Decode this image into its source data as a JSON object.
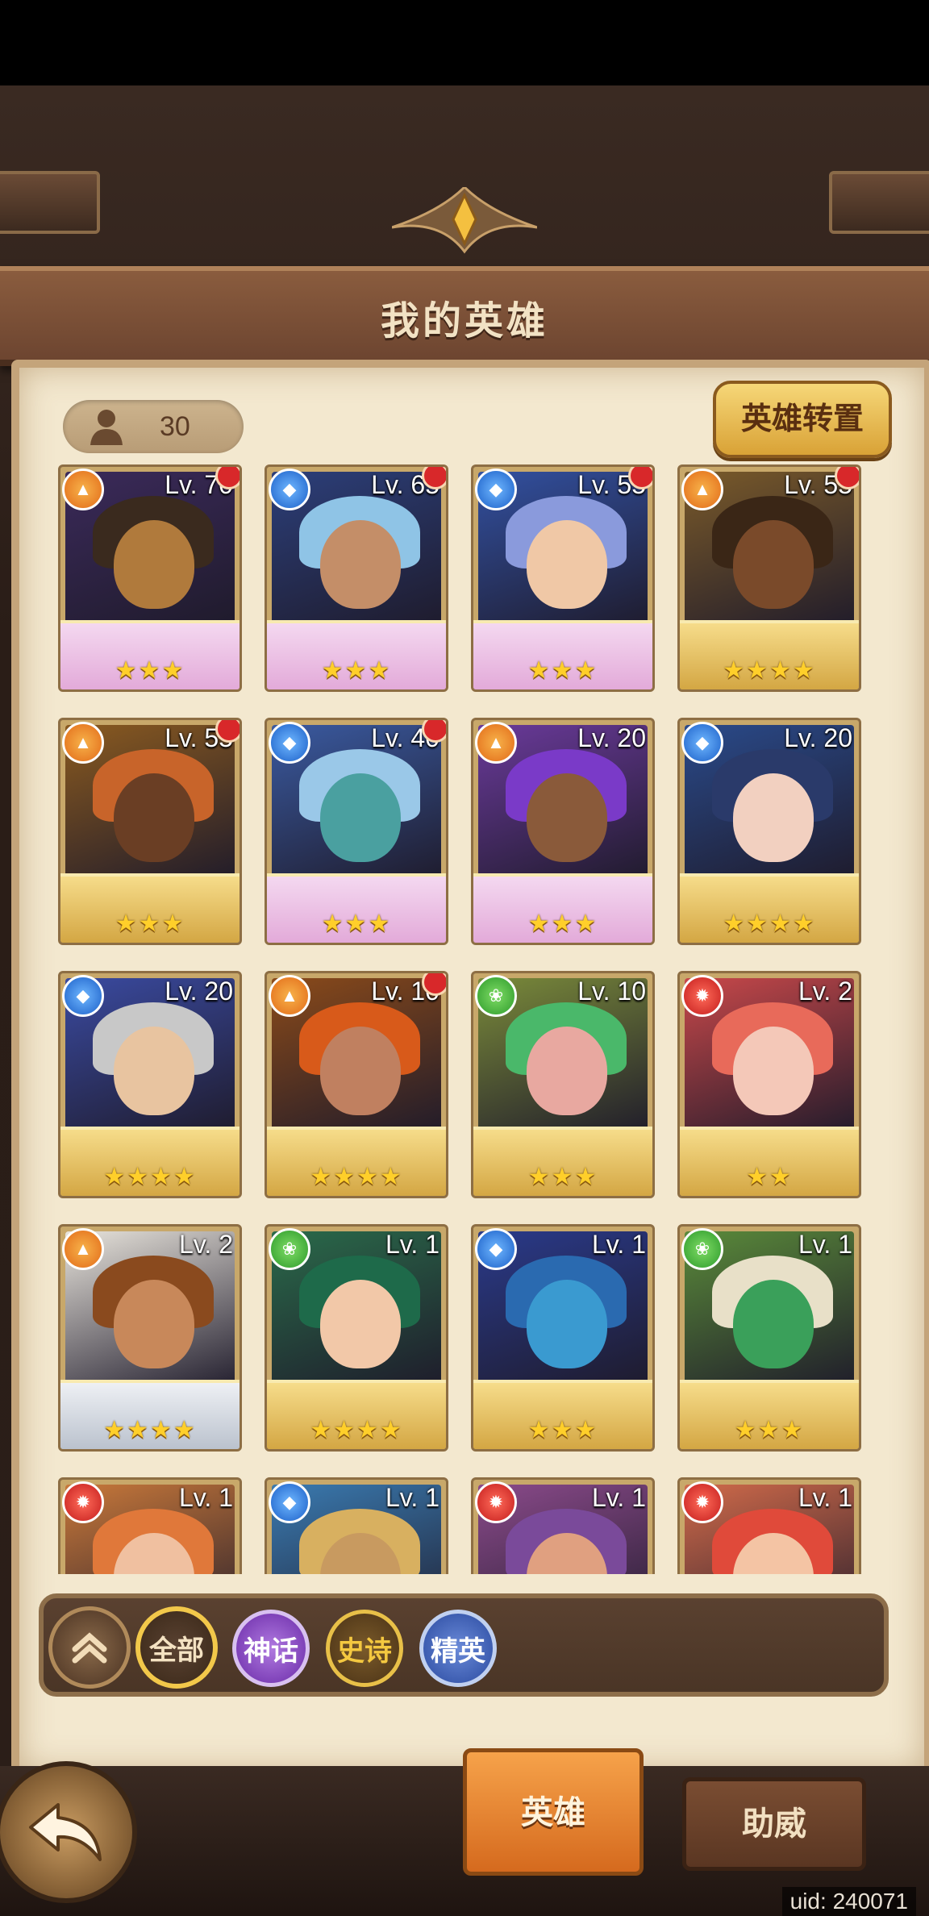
{
  "page": {
    "title": "我的英雄",
    "hero_count": "30",
    "transfer_button": "英雄转置",
    "uid": "uid: 240071"
  },
  "heroes": [
    {
      "level": "Lv. 70",
      "element": "fire",
      "stars": "★★★",
      "badge": true,
      "tier": "mythic",
      "colors": {
        "bg": "#3b2a5a",
        "skin": "#b07a3c",
        "hair": "#3a2a1e"
      }
    },
    {
      "level": "Lv. 65",
      "element": "water",
      "stars": "★★★",
      "badge": true,
      "tier": "mythic",
      "colors": {
        "bg": "#2c3f7a",
        "skin": "#c48e68",
        "hair": "#8fc4e6"
      }
    },
    {
      "level": "Lv. 55",
      "element": "water",
      "stars": "★★★",
      "badge": true,
      "tier": "mythic",
      "colors": {
        "bg": "#3250a0",
        "skin": "#f0c8a6",
        "hair": "#8a9adc"
      }
    },
    {
      "level": "Lv. 55",
      "element": "fire",
      "stars": "★★★★",
      "badge": true,
      "tier": "epic",
      "colors": {
        "bg": "#7a5a2a",
        "skin": "#7a4a2a",
        "hair": "#3a2616"
      }
    },
    {
      "level": "Lv. 55",
      "element": "fire",
      "stars": "★★★",
      "badge": true,
      "tier": "epic",
      "colors": {
        "bg": "#8a5a20",
        "skin": "#6a3e24",
        "hair": "#c8642a"
      }
    },
    {
      "level": "Lv. 40",
      "element": "water",
      "stars": "★★★",
      "badge": true,
      "tier": "mythic",
      "colors": {
        "bg": "#3a5aa0",
        "skin": "#4aa0a0",
        "hair": "#9ac8e8"
      }
    },
    {
      "level": "Lv. 20",
      "element": "fire",
      "stars": "★★★",
      "badge": false,
      "tier": "mythic",
      "colors": {
        "bg": "#6a3a9a",
        "skin": "#8a5a3a",
        "hair": "#7a3ac8"
      }
    },
    {
      "level": "Lv. 20",
      "element": "water",
      "stars": "★★★★",
      "badge": false,
      "tier": "epic",
      "colors": {
        "bg": "#2a4a8a",
        "skin": "#f2d0c0",
        "hair": "#2a3a6a"
      }
    },
    {
      "level": "Lv. 20",
      "element": "water",
      "stars": "★★★★",
      "badge": false,
      "tier": "epic",
      "colors": {
        "bg": "#3a4aa0",
        "skin": "#e8c4a0",
        "hair": "#c8c8c8"
      }
    },
    {
      "level": "Lv. 10",
      "element": "fire",
      "stars": "★★★★",
      "badge": true,
      "tier": "epic",
      "colors": {
        "bg": "#8a4a1a",
        "skin": "#c08060",
        "hair": "#d85a1a"
      }
    },
    {
      "level": "Lv. 10",
      "element": "nature",
      "stars": "★★★",
      "badge": false,
      "tier": "epic",
      "colors": {
        "bg": "#7a8a3a",
        "skin": "#e8a8a0",
        "hair": "#4ab86a"
      }
    },
    {
      "level": "Lv. 2",
      "element": "blaze",
      "stars": "★★",
      "badge": false,
      "tier": "epic",
      "colors": {
        "bg": "#c8484a",
        "skin": "#f4c8b8",
        "hair": "#e86a5a"
      }
    },
    {
      "level": "Lv. 2",
      "element": "fire",
      "stars": "★★★★",
      "badge": false,
      "tier": "rare",
      "colors": {
        "bg": "#e8e4dc",
        "skin": "#c8885a",
        "hair": "#8a4a1e"
      }
    },
    {
      "level": "Lv. 1",
      "element": "nature",
      "stars": "★★★★",
      "badge": false,
      "tier": "epic",
      "colors": {
        "bg": "#2a6a4a",
        "skin": "#f2c8a8",
        "hair": "#1e6a4a"
      }
    },
    {
      "level": "Lv. 1",
      "element": "water",
      "stars": "★★★",
      "badge": false,
      "tier": "epic",
      "colors": {
        "bg": "#2a3a8a",
        "skin": "#3a9ad0",
        "hair": "#2a6ab0"
      }
    },
    {
      "level": "Lv. 1",
      "element": "nature",
      "stars": "★★★",
      "badge": false,
      "tier": "epic",
      "colors": {
        "bg": "#5a8a3a",
        "skin": "#3aa05a",
        "hair": "#e8e0c8"
      }
    },
    {
      "level": "Lv. 1",
      "element": "blaze",
      "stars": "",
      "badge": false,
      "tier": "epic",
      "colors": {
        "bg": "#c8783a",
        "skin": "#f0c0a0",
        "hair": "#e0783a"
      }
    },
    {
      "level": "Lv. 1",
      "element": "water",
      "stars": "",
      "badge": false,
      "tier": "epic",
      "colors": {
        "bg": "#3a7ab0",
        "skin": "#c89a60",
        "hair": "#d8b060"
      }
    },
    {
      "level": "Lv. 1",
      "element": "blaze",
      "stars": "",
      "badge": false,
      "tier": "epic",
      "colors": {
        "bg": "#8a4a8a",
        "skin": "#e0a080",
        "hair": "#7a4a9a"
      }
    },
    {
      "level": "Lv. 1",
      "element": "blaze",
      "stars": "",
      "badge": false,
      "tier": "epic",
      "colors": {
        "bg": "#d06a4a",
        "skin": "#f4c4a4",
        "hair": "#e04a3a"
      }
    }
  ],
  "filters": {
    "all": "全部",
    "mythic": "神话",
    "epic": "史诗",
    "elite": "精英"
  },
  "tabs": {
    "hero": "英雄",
    "assist": "助威"
  },
  "colors": {
    "panel": "#f3e8cf",
    "accent": "#d9a236",
    "badge": "#d8282a"
  }
}
